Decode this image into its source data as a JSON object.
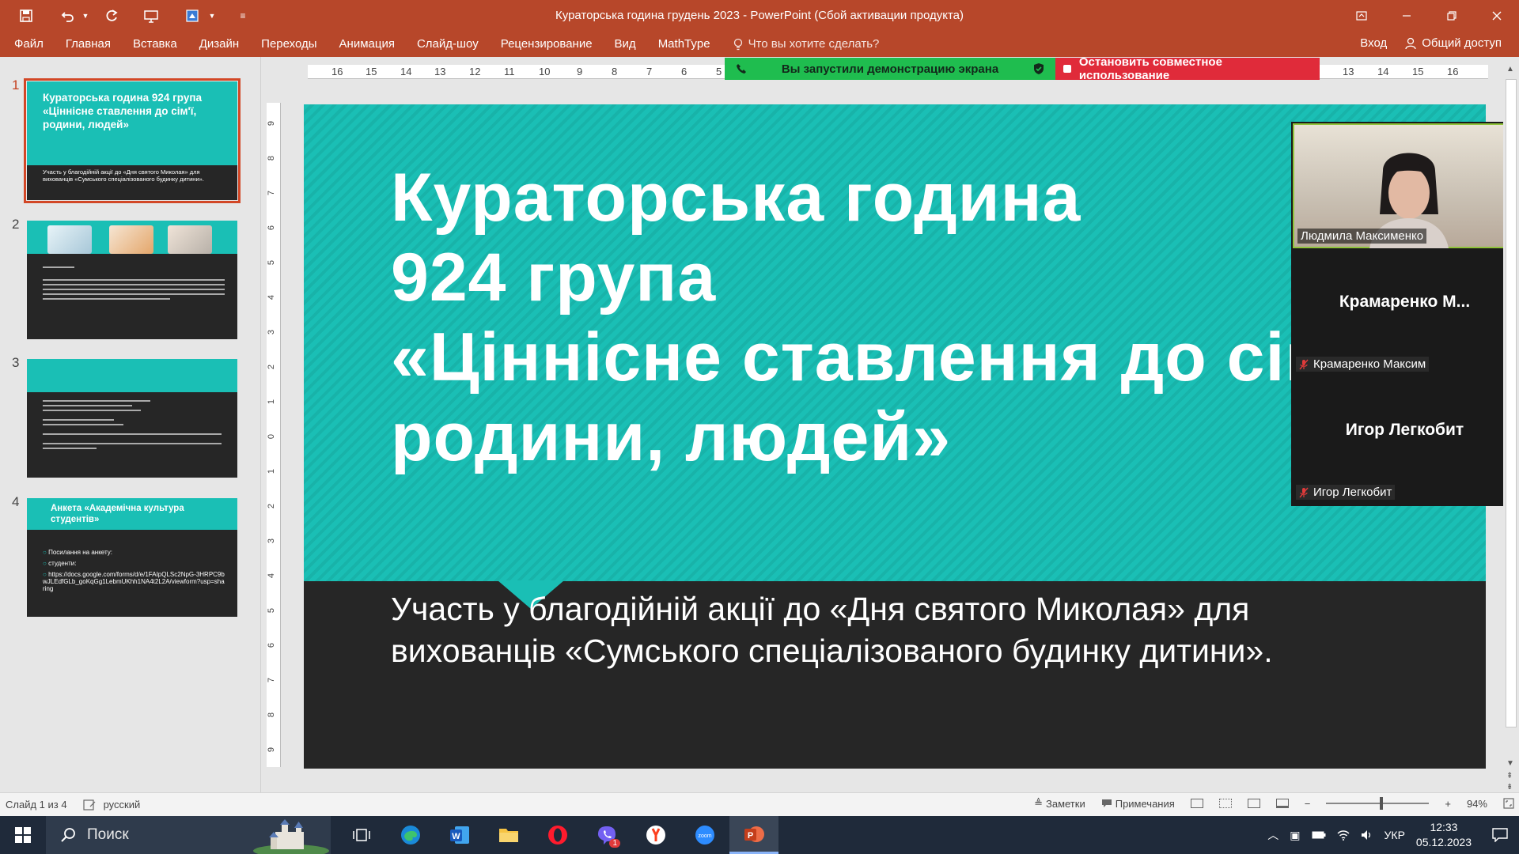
{
  "window": {
    "title": "Кураторська година грудень 2023 - PowerPoint (Сбой активации продукта)"
  },
  "ribbon": {
    "tabs": [
      "Файл",
      "Главная",
      "Вставка",
      "Дизайн",
      "Переходы",
      "Анимация",
      "Слайд-шоу",
      "Рецензирование",
      "Вид",
      "MathType"
    ],
    "tell_me_placeholder": "Что вы хотите сделать?",
    "signin_label": "Вход",
    "share_label": "Общий доступ"
  },
  "thumbnails": [
    {
      "number": "1",
      "title": "Кураторська година 924 група «Ціннісне ставлення до сім'ї, родини, людей»",
      "subtitle": "Участь у благодійній акції до «Дня святого Миколая» для вихованців «Сумського спеціалізованого будинку дитини»."
    },
    {
      "number": "2"
    },
    {
      "number": "3"
    },
    {
      "number": "4",
      "title": "Анкета «Академічна культура студентів»",
      "bullets": [
        "Посилання на анкету:",
        "студенти:",
        "https://docs.google.com/forms/d/e/1FAIpQLSc2NpG-3HRPC9bwJLEdfGLb_goKqGg1LebmUKhh1NA4t2L2A/viewform?usp=sharing"
      ]
    }
  ],
  "ruler": {
    "h_labels": [
      "16",
      "15",
      "14",
      "13",
      "12",
      "11",
      "10",
      "9",
      "8",
      "7",
      "6",
      "5",
      "13",
      "14",
      "15",
      "16"
    ],
    "v_labels": [
      "9",
      "8",
      "7",
      "6",
      "5",
      "4",
      "3",
      "2",
      "1",
      "0",
      "1",
      "2",
      "3",
      "4",
      "5",
      "6",
      "7",
      "8",
      "9"
    ]
  },
  "slide": {
    "title_lines": [
      "Кураторська година",
      "924 група",
      "«Ціннісне ставлення до сім",
      "родини, людей»"
    ],
    "subtitle": "Участь у благодійній акції до «Дня святого Миколая» для вихованців «Сумського спеціалізованого будинку дитини»."
  },
  "screen_share": {
    "status": "Вы запустили демонстрацию экрана",
    "stop_label": "Остановить совместное использование"
  },
  "participants": [
    {
      "name": "Людмила Максименко",
      "video_on": true
    },
    {
      "display": "Крамаренко  М...",
      "name": "Крамаренко Максим",
      "muted": true
    },
    {
      "display": "Игор Легкобит",
      "name": "Игор Легкобит",
      "muted": true
    }
  ],
  "status_bar": {
    "slide_info": "Слайд 1 из 4",
    "language": "русский",
    "notes_label": "Заметки",
    "comments_label": "Примечания",
    "zoom": "94%"
  },
  "taskbar": {
    "search_placeholder": "Поиск",
    "viber_badge": "1",
    "zoom_label": "zoom",
    "language": "УКР",
    "time": "12:33",
    "date": "05.12.2023"
  },
  "colors": {
    "ppt_accent": "#b7472a",
    "slide_teal": "#1abfb5",
    "slide_dark": "#262626",
    "share_green": "#1fbd4f",
    "share_red": "#e02b3a"
  }
}
